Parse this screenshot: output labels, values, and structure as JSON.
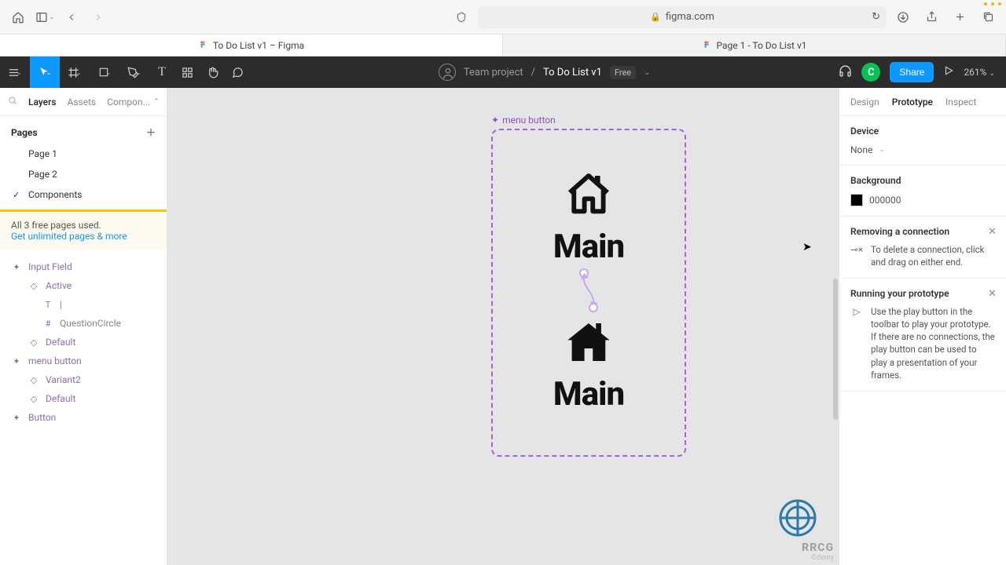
{
  "browser": {
    "url_host": "figma.com",
    "tabs": [
      {
        "label": "To Do List v1 – Figma",
        "active": true
      },
      {
        "label": "Page 1 - To Do List v1",
        "active": false
      }
    ]
  },
  "toolbar": {
    "team": "Team project",
    "file": "To Do List v1",
    "plan": "Free",
    "user_initial": "C",
    "share": "Share",
    "zoom": "261%"
  },
  "left": {
    "tabs": {
      "layers": "Layers",
      "assets": "Assets",
      "library": "Compon..."
    },
    "pages_header": "Pages",
    "pages": [
      "Page 1",
      "Page 2",
      "Components"
    ],
    "upgrade_line1": "All 3 free pages used.",
    "upgrade_link": "Get unlimited pages & more",
    "layers": {
      "input_field": "Input Field",
      "active": "Active",
      "text_cursor": "|",
      "question_circle": "QuestionCircle",
      "default1": "Default",
      "menu_button": "menu button",
      "variant2": "Variant2",
      "default2": "Default",
      "button": "Button"
    }
  },
  "canvas": {
    "frame_label": "menu button",
    "variant_text": "Main"
  },
  "right": {
    "tabs": {
      "design": "Design",
      "prototype": "Prototype",
      "inspect": "Inspect"
    },
    "device_h": "Device",
    "device_v": "None",
    "bg_h": "Background",
    "bg_v": "000000",
    "hint1_h": "Removing a connection",
    "hint1_b": "To delete a connection, click and drag on either end.",
    "hint2_h": "Running your prototype",
    "hint2_b": "Use the play button in the toolbar to play your prototype. If there are no connections, the play button can be used to play a presentation of your frames."
  },
  "watermark": {
    "text": "RRCG",
    "sub": "©demy"
  }
}
